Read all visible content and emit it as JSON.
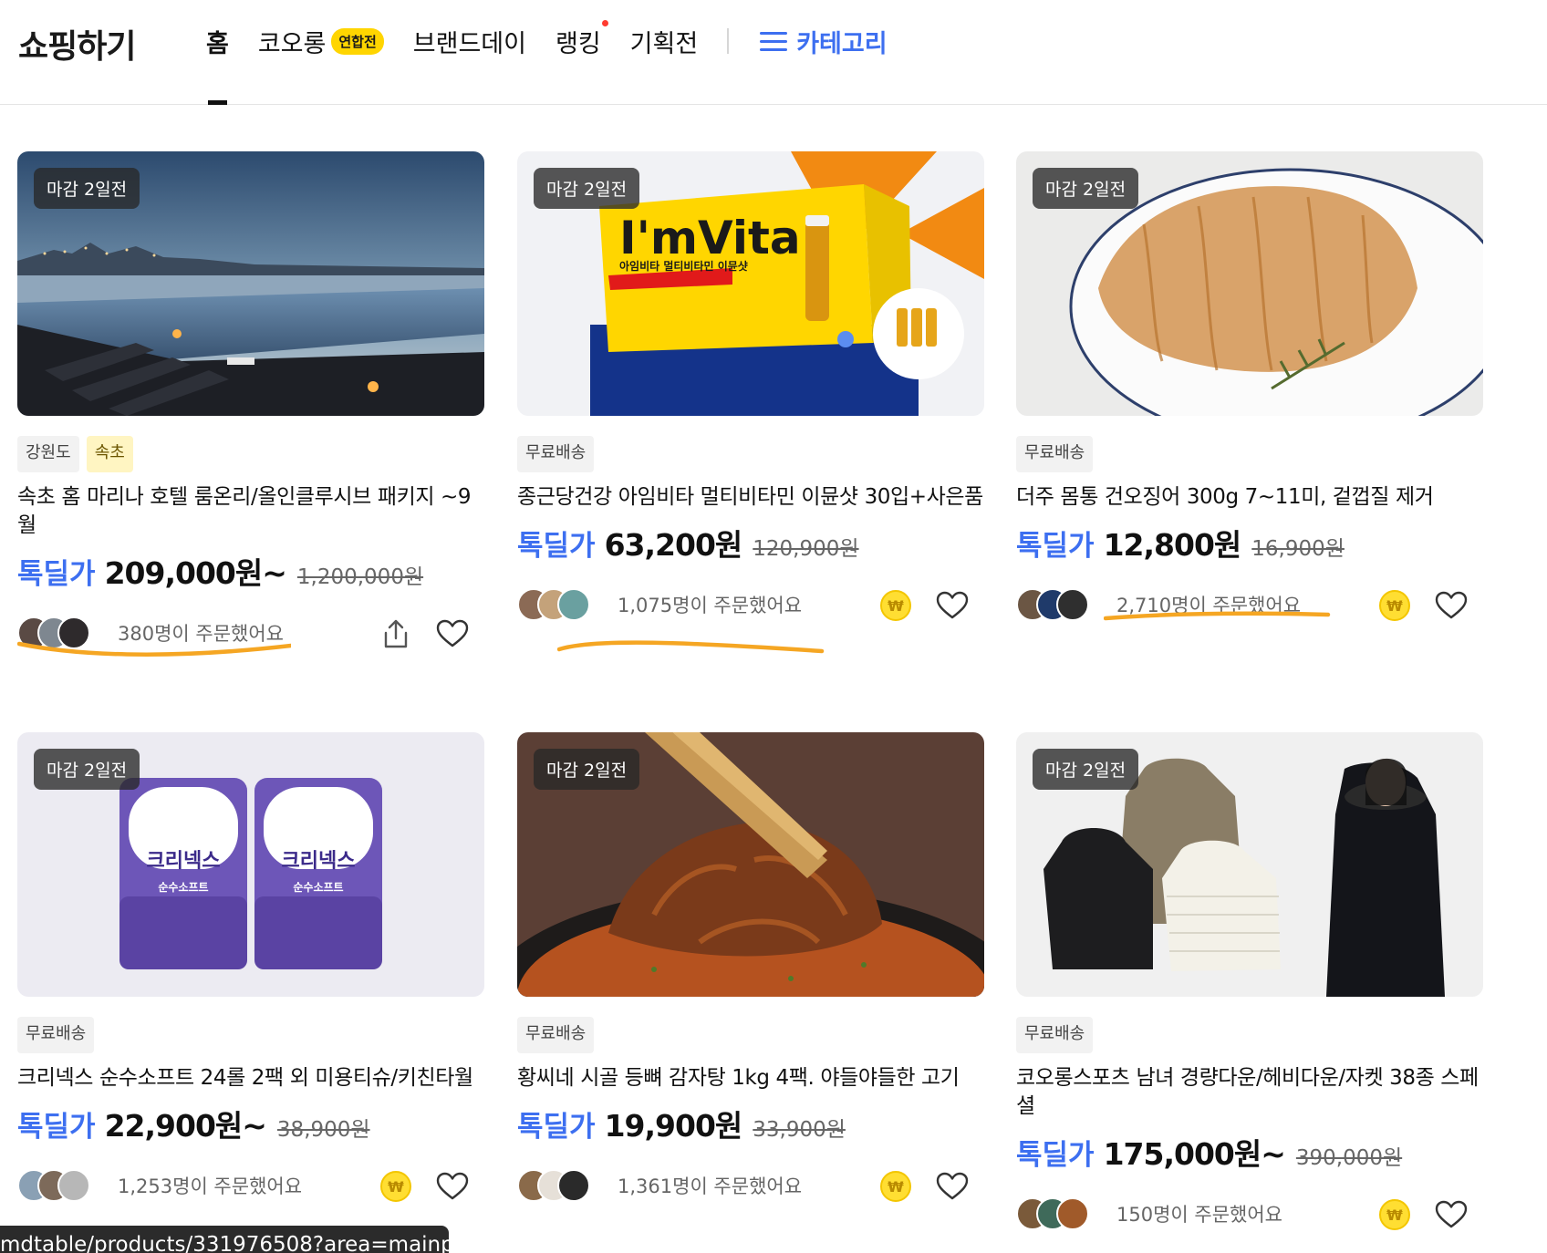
{
  "header": {
    "logo": "쇼핑하기",
    "nav": [
      {
        "label": "홈"
      },
      {
        "label": "코오롱",
        "badge": "연합전"
      },
      {
        "label": "브랜드데이"
      },
      {
        "label": "랭킹"
      },
      {
        "label": "기획전"
      }
    ],
    "category_label": "카테고리"
  },
  "accent_color": "#3d6ff0",
  "highlight_color": "#f5a623",
  "products": [
    {
      "deadline": "마감 2일전",
      "tags": [
        "강원도",
        "속초"
      ],
      "title": "속초 홈 마리나 호텔 룸온리/올인클루시브 패키지 ~9월",
      "price_label": "톡딜가",
      "price": "209,000원~",
      "original_price": "1,200,000원",
      "orders": "380명이 주문했어요",
      "actions": [
        "share-icon",
        "heart-icon"
      ]
    },
    {
      "deadline": "마감 2일전",
      "tags": [
        "무료배송"
      ],
      "title": "종근당건강 아임비타 멀티비타민 이뮨샷 30입+사은품",
      "image_brand": "I'mVita",
      "image_subtitle": "아임비타 멀티비타민 이뮨샷",
      "price_label": "톡딜가",
      "price": "63,200원",
      "original_price": "120,900원",
      "orders": "1,075명이 주문했어요",
      "actions": [
        "coin-icon",
        "heart-icon"
      ]
    },
    {
      "deadline": "마감 2일전",
      "tags": [
        "무료배송"
      ],
      "title": "더주 몸통 건오징어 300g 7~11미, 겉껍질 제거",
      "price_label": "톡딜가",
      "price": "12,800원",
      "original_price": "16,900원",
      "orders": "2,710명이 주문했어요",
      "actions": [
        "coin-icon",
        "heart-icon"
      ]
    },
    {
      "deadline": "마감 2일전",
      "tags": [
        "무료배송"
      ],
      "title": "크리넥스 순수소프트 24롤 2팩 외 미용티슈/키친타월",
      "image_brand": "크리넥스",
      "image_subtitle": "순수소프트",
      "price_label": "톡딜가",
      "price": "22,900원~",
      "original_price": "38,900원",
      "orders": "1,253명이 주문했어요",
      "actions": [
        "coin-icon",
        "heart-icon"
      ]
    },
    {
      "deadline": "마감 2일전",
      "tags": [
        "무료배송"
      ],
      "title": "황씨네 시골 등뼈 감자탕 1kg 4팩. 야들야들한 고기",
      "price_label": "톡딜가",
      "price": "19,900원",
      "original_price": "33,900원",
      "orders": "1,361명이 주문했어요",
      "actions": [
        "coin-icon",
        "heart-icon"
      ]
    },
    {
      "deadline": "마감 2일전",
      "tags": [
        "무료배송"
      ],
      "title": "코오롱스포츠 남녀 경량다운/헤비다운/자켓 38종 스페셜",
      "price_label": "톡딜가",
      "price": "175,000원~",
      "original_price": "390,000원",
      "orders": "150명이 주문했어요",
      "actions": [
        "coin-icon",
        "heart-icon"
      ]
    }
  ],
  "coin_symbol": "₩",
  "status_url": "mdtable/products/331976508?area=mainp"
}
